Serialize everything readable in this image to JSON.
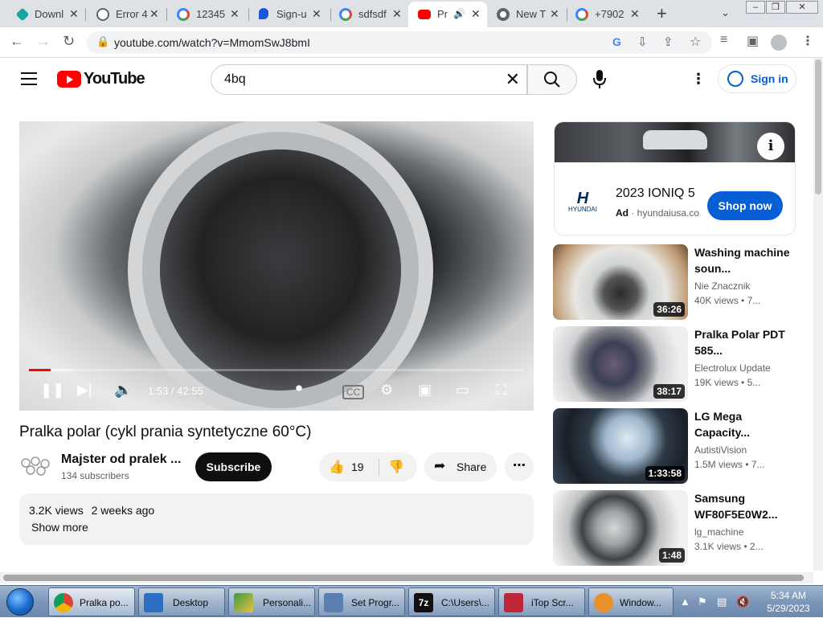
{
  "browser": {
    "tabs": [
      {
        "label": "Downl",
        "icon": "gem-icon",
        "color": "#1aa3a3"
      },
      {
        "label": "Error 4",
        "icon": "globe-icon",
        "color": "#5f6368"
      },
      {
        "label": "12345",
        "icon": "google-icon",
        "color": "#4285f4"
      },
      {
        "label": "Sign-u",
        "icon": "person-pin-icon",
        "color": "#1a56db"
      },
      {
        "label": "sdfsdf",
        "icon": "google-icon",
        "color": "#4285f4"
      },
      {
        "label": "Pr",
        "icon": "youtube-icon",
        "color": "#ff0000",
        "active": true
      },
      {
        "label": "New T",
        "icon": "chrome-icon",
        "color": "#5f6368"
      },
      {
        "label": "+7902",
        "icon": "google-icon",
        "color": "#4285f4"
      }
    ],
    "new_tab": "+",
    "url": "youtube.com/watch?v=MmomSwJ8bmI"
  },
  "youtube": {
    "logo_text": "YouTube",
    "search_value": "4bq",
    "sign_in": "Sign in"
  },
  "player": {
    "current_time": "1:53",
    "duration": "42:55",
    "time_display": "1:53 / 42:55",
    "progress_fraction": 0.044,
    "buffered_fraction": 0.09
  },
  "video": {
    "title": "Pralka polar (cykl prania syntetyczne 60°C)",
    "channel": "Majster od pralek ...",
    "subscribers": "134 subscribers",
    "subscribe": "Subscribe",
    "likes": "19",
    "share": "Share",
    "views": "3.2K views",
    "age": "2 weeks ago",
    "show_more": "Show more"
  },
  "ad": {
    "brand": "HYUNDAI",
    "title": "2023 IONIQ 5",
    "ad_label": "Ad",
    "domain": "hyundaiusa.co",
    "cta": "Shop now"
  },
  "recommended": [
    {
      "title": "Washing machine soun...",
      "channel": "Nie Znacznik",
      "views": "40K views",
      "age": "7...",
      "duration": "36:26"
    },
    {
      "title": "Pralka Polar PDT 585...",
      "channel": "Electrolux Update",
      "views": "19K views",
      "age": "5...",
      "duration": "38:17"
    },
    {
      "title": "LG Mega Capacity...",
      "channel": "AutistiVision",
      "views": "1.5M views",
      "age": "7...",
      "duration": "1:33:58"
    },
    {
      "title": "Samsung WF80F5E0W2...",
      "channel": "lg_machine",
      "views": "3.1K views",
      "age": "2...",
      "duration": "1:48"
    }
  ],
  "taskbar": {
    "items": [
      {
        "label": "Pralka po...",
        "icon": "chrome-icon",
        "color": "#db4437"
      },
      {
        "label": "Desktop",
        "icon": "monitor-icon",
        "color": "#2c6fc2"
      },
      {
        "label": "Personali...",
        "icon": "personalize-icon",
        "color": "#3a9a4a"
      },
      {
        "label": "Set Progr...",
        "icon": "program-icon",
        "color": "#5b7fae"
      },
      {
        "label": "C:\\Users\\...",
        "icon": "7zip-icon",
        "color": "#111111"
      },
      {
        "label": "iTop Scr...",
        "icon": "recorder-icon",
        "color": "#c0263a"
      },
      {
        "label": "Window...",
        "icon": "media-player-icon",
        "color": "#e8912a"
      }
    ],
    "time": "5:34 AM",
    "date": "5/29/2023"
  },
  "colors": {
    "yt_red": "#ff0000",
    "link_blue": "#065fd4",
    "chip_gray": "#f2f2f2"
  }
}
